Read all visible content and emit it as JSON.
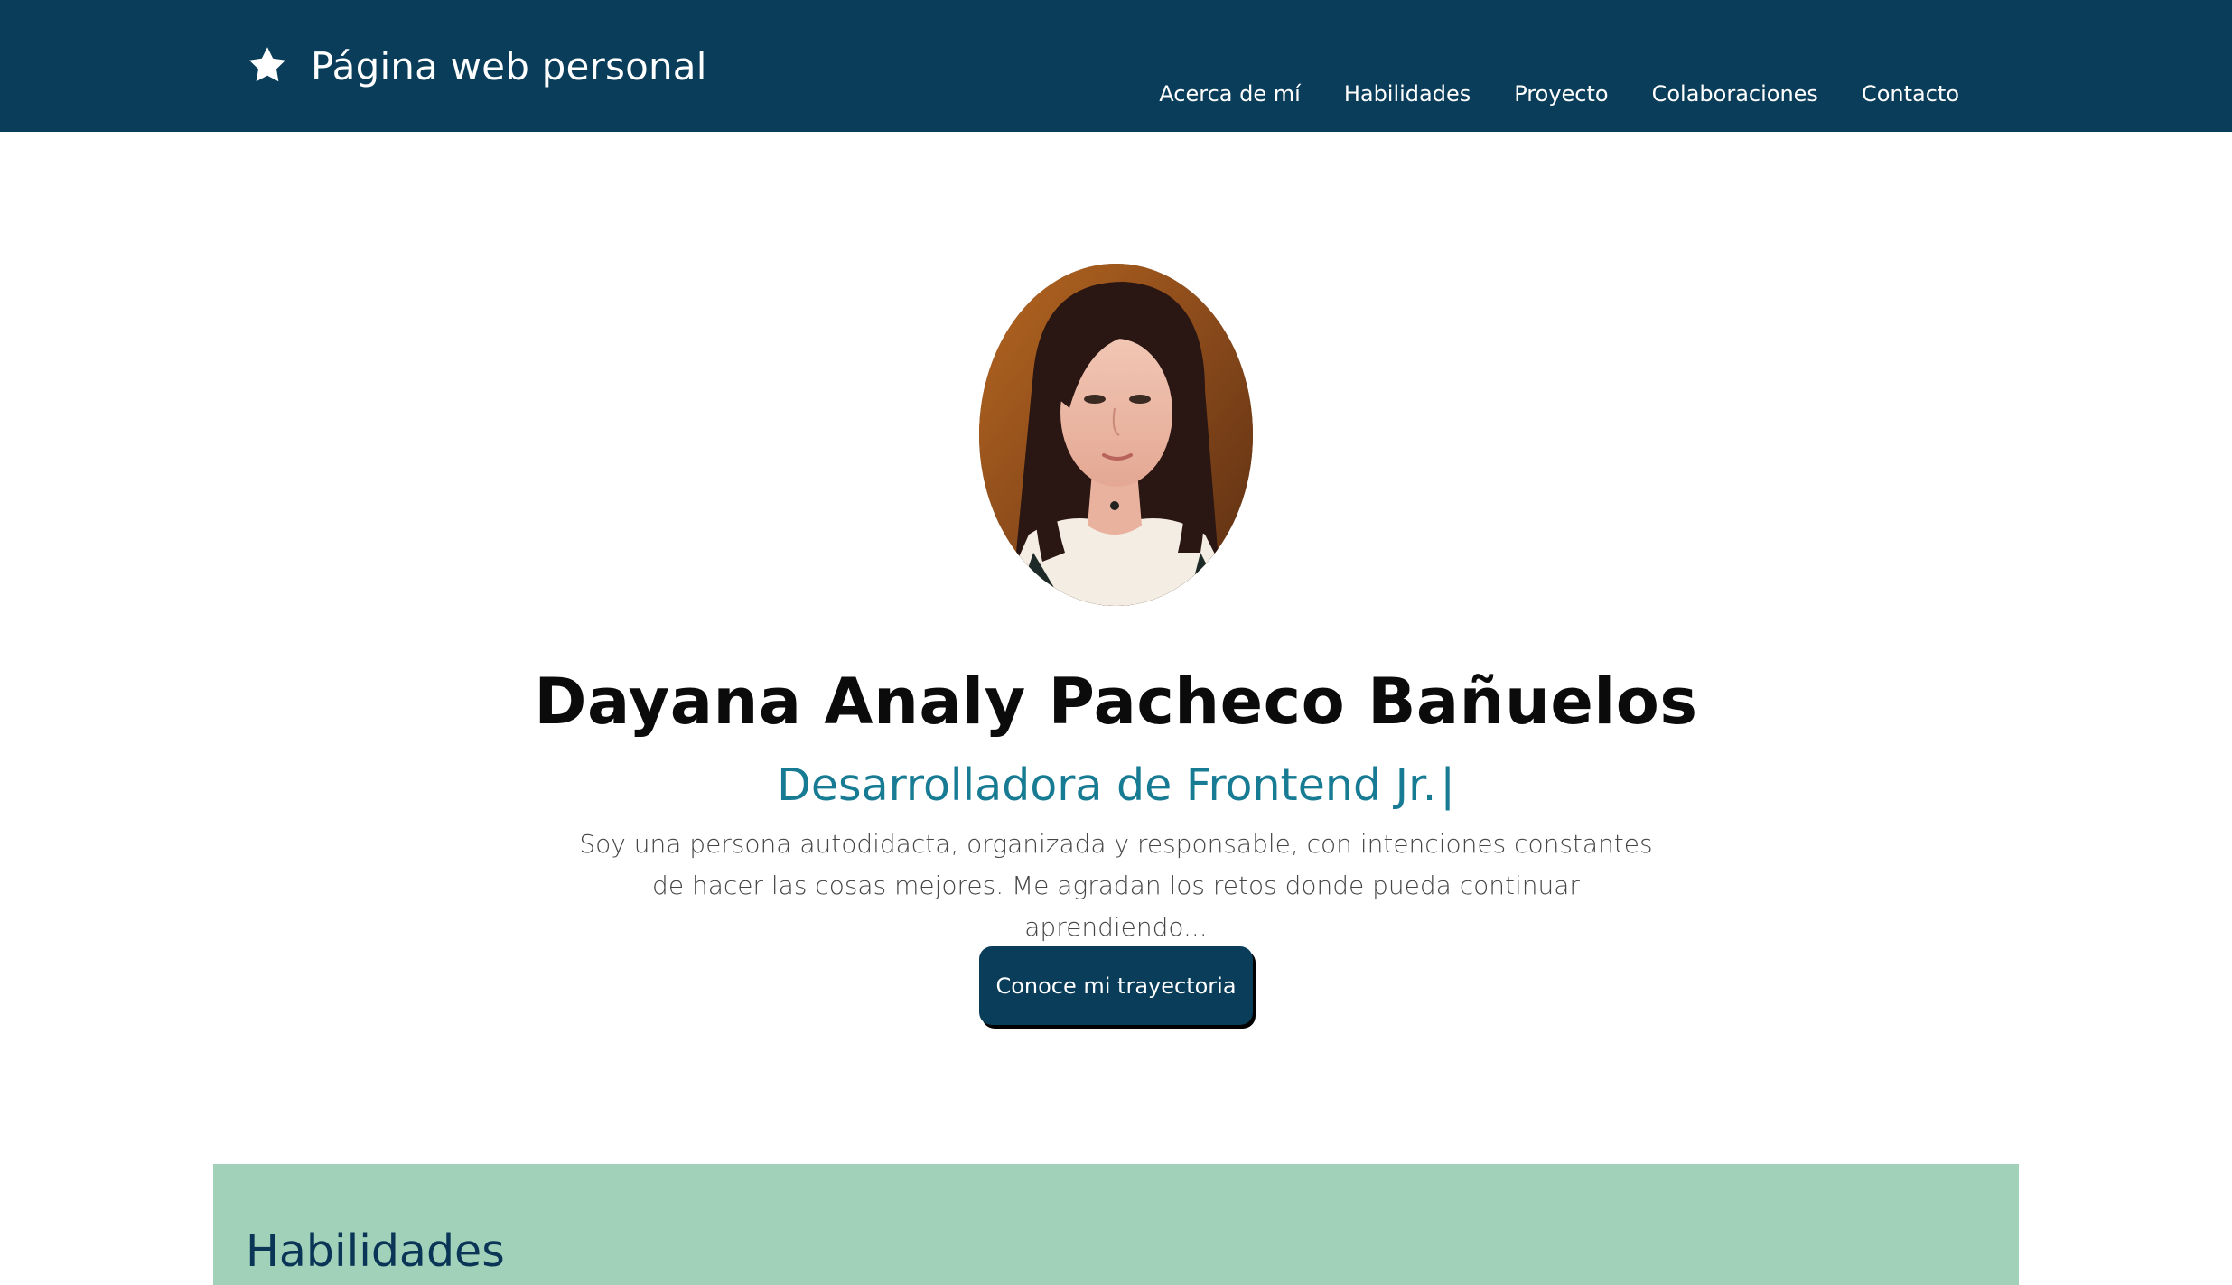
{
  "navbar": {
    "brand_icon": "star-icon",
    "brand_text": "Página web personal",
    "links": [
      {
        "label": "Acerca de mí"
      },
      {
        "label": "Habilidades"
      },
      {
        "label": "Proyecto"
      },
      {
        "label": "Colaboraciones"
      },
      {
        "label": "Contacto"
      }
    ]
  },
  "hero": {
    "avatar_alt": "profile-photo",
    "name": "Dayana Analy Pacheco Bañuelos",
    "role": "Desarrolladora de Frontend Jr.",
    "role_cursor": "|",
    "description": "Soy una persona autodidacta, organizada y responsable, con intenciones constantes de hacer las cosas mejores. Me agradan los retos donde pueda continuar aprendiendo...",
    "cta_label": "Conoce mi trayectoria"
  },
  "skills": {
    "title": "Habilidades"
  },
  "colors": {
    "navbar_bg": "#0a3d5a",
    "accent": "#167b93",
    "skills_bg": "#a1d1b9",
    "skills_title": "#0a3557"
  }
}
